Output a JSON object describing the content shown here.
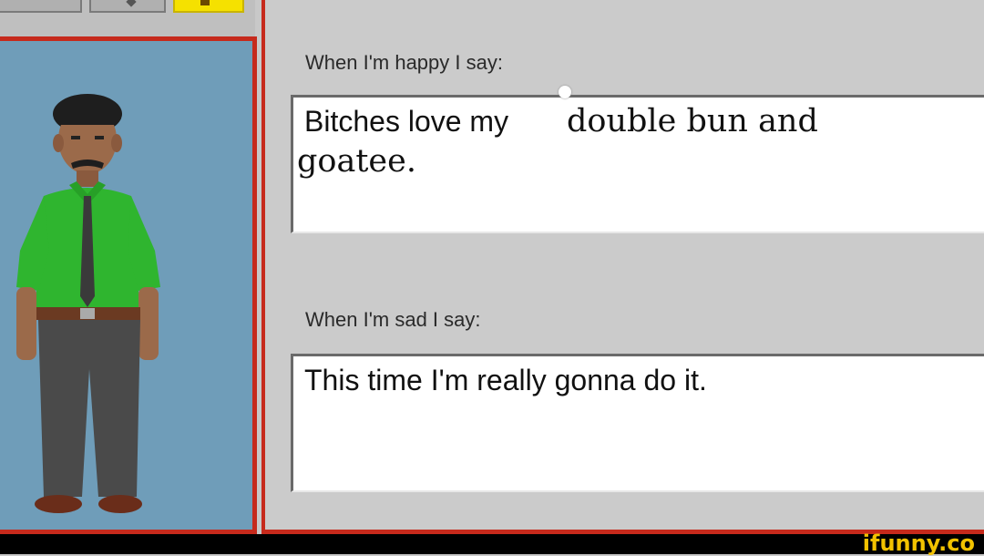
{
  "happy": {
    "label": "When I'm happy I say:",
    "text_line1": "Bitches love my",
    "overlay_line1": "double bun and",
    "overlay_line2": "goatee."
  },
  "sad": {
    "label": "When I'm sad I say:",
    "text": "This time I'm really gonna do it."
  },
  "watermark": "ifunny.co",
  "colors": {
    "border_red": "#c62a1c",
    "panel_blue": "#6f9db9",
    "shirt_green": "#2fb52f",
    "watermark_yellow": "#f2c200"
  },
  "icons": [
    "toolbar-button-icon",
    "toolbar-arrow-icon",
    "toolbar-folder-icon",
    "character-avatar"
  ]
}
